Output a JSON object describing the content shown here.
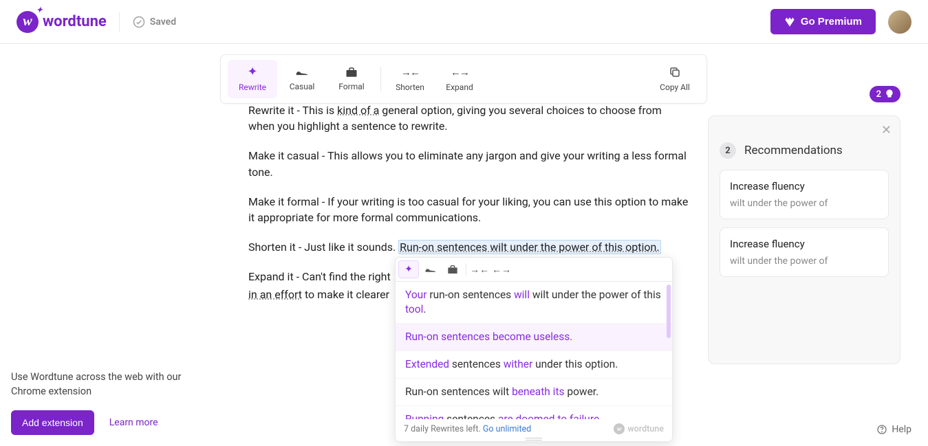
{
  "header": {
    "brand": "wordtune",
    "saved_label": "Saved",
    "premium_label": "Go Premium"
  },
  "toolbar": {
    "items": [
      {
        "label": "Rewrite",
        "icon": "sparkle",
        "active": true
      },
      {
        "label": "Casual",
        "icon": "sneaker",
        "active": false
      },
      {
        "label": "Formal",
        "icon": "briefcase",
        "active": false
      },
      {
        "label": "Shorten",
        "icon": "arrows-in",
        "active": false
      },
      {
        "label": "Expand",
        "icon": "arrows-out",
        "active": false
      }
    ],
    "copy_all_label": "Copy All"
  },
  "editor": {
    "p0_a": "Rewrite it - This is ",
    "p0_b": "kind of a",
    "p0_c": " general option, giving you several choices to choose from",
    "p1": "when you highlight a sentence to rewrite.",
    "p2": "Make it casual - This allows you to eliminate any jargon and give your writing a less formal tone.",
    "p3": "Make it formal - If your writing is too casual for your liking, you can use this option to make it appropriate for more formal communications.",
    "p4_a": "Shorten it - Just like it sounds. ",
    "p4_highlight": "Run-on sentences wilt under the power of this option.",
    "p5_a": "Expand it - Can't find the right",
    "p6_a": "in an effort",
    "p6_b": " to make it clearer"
  },
  "popup": {
    "suggestions": [
      {
        "parts": [
          {
            "t": "Your",
            "h": true
          },
          {
            "t": " run-on sentences "
          },
          {
            "t": "will",
            "h": true
          },
          {
            "t": " wilt under the power of this "
          },
          {
            "t": "tool",
            "h": true
          },
          {
            "t": "."
          }
        ],
        "selected": false
      },
      {
        "parts": [
          {
            "t": "Run-on sentences become useless.",
            "h": true
          }
        ],
        "selected": true
      },
      {
        "parts": [
          {
            "t": "Extended",
            "h": true
          },
          {
            "t": " sentences "
          },
          {
            "t": "wither",
            "h": true
          },
          {
            "t": " under this option."
          }
        ],
        "selected": false
      },
      {
        "parts": [
          {
            "t": "Run-on sentences wilt "
          },
          {
            "t": "beneath its",
            "h": true
          },
          {
            "t": " power."
          }
        ],
        "selected": false
      },
      {
        "parts": [
          {
            "t": "Running",
            "h": true
          },
          {
            "t": " sentences "
          },
          {
            "t": "are doomed to failure",
            "h": true
          },
          {
            "t": "."
          }
        ],
        "selected": false
      }
    ],
    "footer_a": "7 daily Rewrites left. ",
    "footer_link": "Go unlimited",
    "brand": "wordtune"
  },
  "recommendations": {
    "badge_count": "2",
    "title": "Recommendations",
    "count": "2",
    "cards": [
      {
        "title": "Increase fluency",
        "sub": "wilt under the power of"
      },
      {
        "title": "Increase fluency",
        "sub": "wilt under the power of"
      }
    ]
  },
  "extension": {
    "text": "Use Wordtune across the web with our Chrome extension",
    "button": "Add extension",
    "learn_more": "Learn more"
  },
  "help": "Help"
}
